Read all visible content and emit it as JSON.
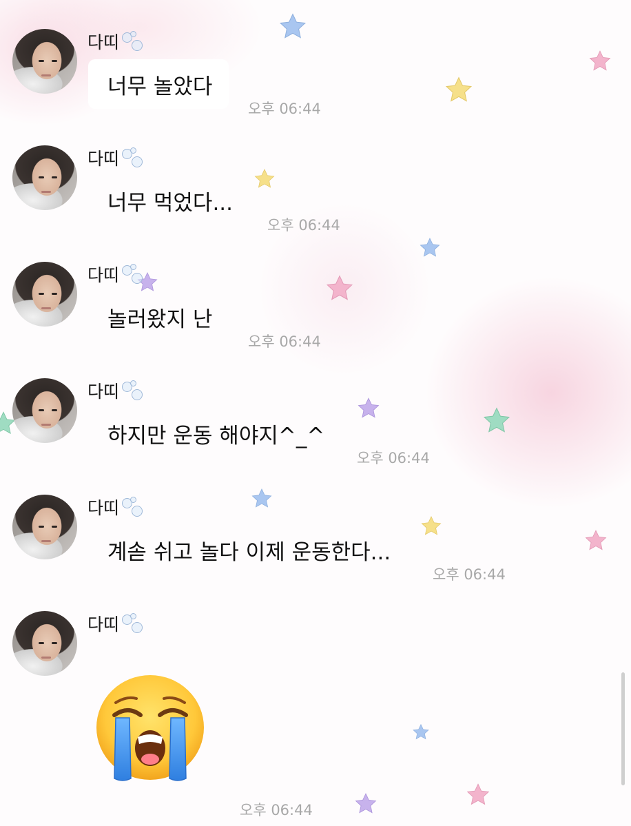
{
  "messages": [
    {
      "sender": "다띠",
      "text": "너무 놀았다",
      "time": "오후 06:44"
    },
    {
      "sender": "다띠",
      "text": "너무 먹었다...",
      "time": "오후 06:44"
    },
    {
      "sender": "다띠",
      "text": "놀러왔지 난",
      "time": "오후 06:44"
    },
    {
      "sender": "다띠",
      "text": "하지만 운동 해야지^_^",
      "time": "오후 06:44"
    },
    {
      "sender": "다띠",
      "text": "계솓 쉬고 놀다 이제 운동한다...",
      "time": "오후 06:44"
    },
    {
      "sender": "다띠",
      "emoji": "loudly-crying-face",
      "time": "오후 06:44"
    }
  ],
  "colors": {
    "star_blue": "#a9c6f0",
    "star_yellow": "#f6e08a",
    "star_pink": "#f3b4cc",
    "star_purple": "#c7b2ec",
    "star_green": "#9fdcc2",
    "timestamp": "#a8a8a8",
    "background_pink": "#f5c8d7"
  }
}
